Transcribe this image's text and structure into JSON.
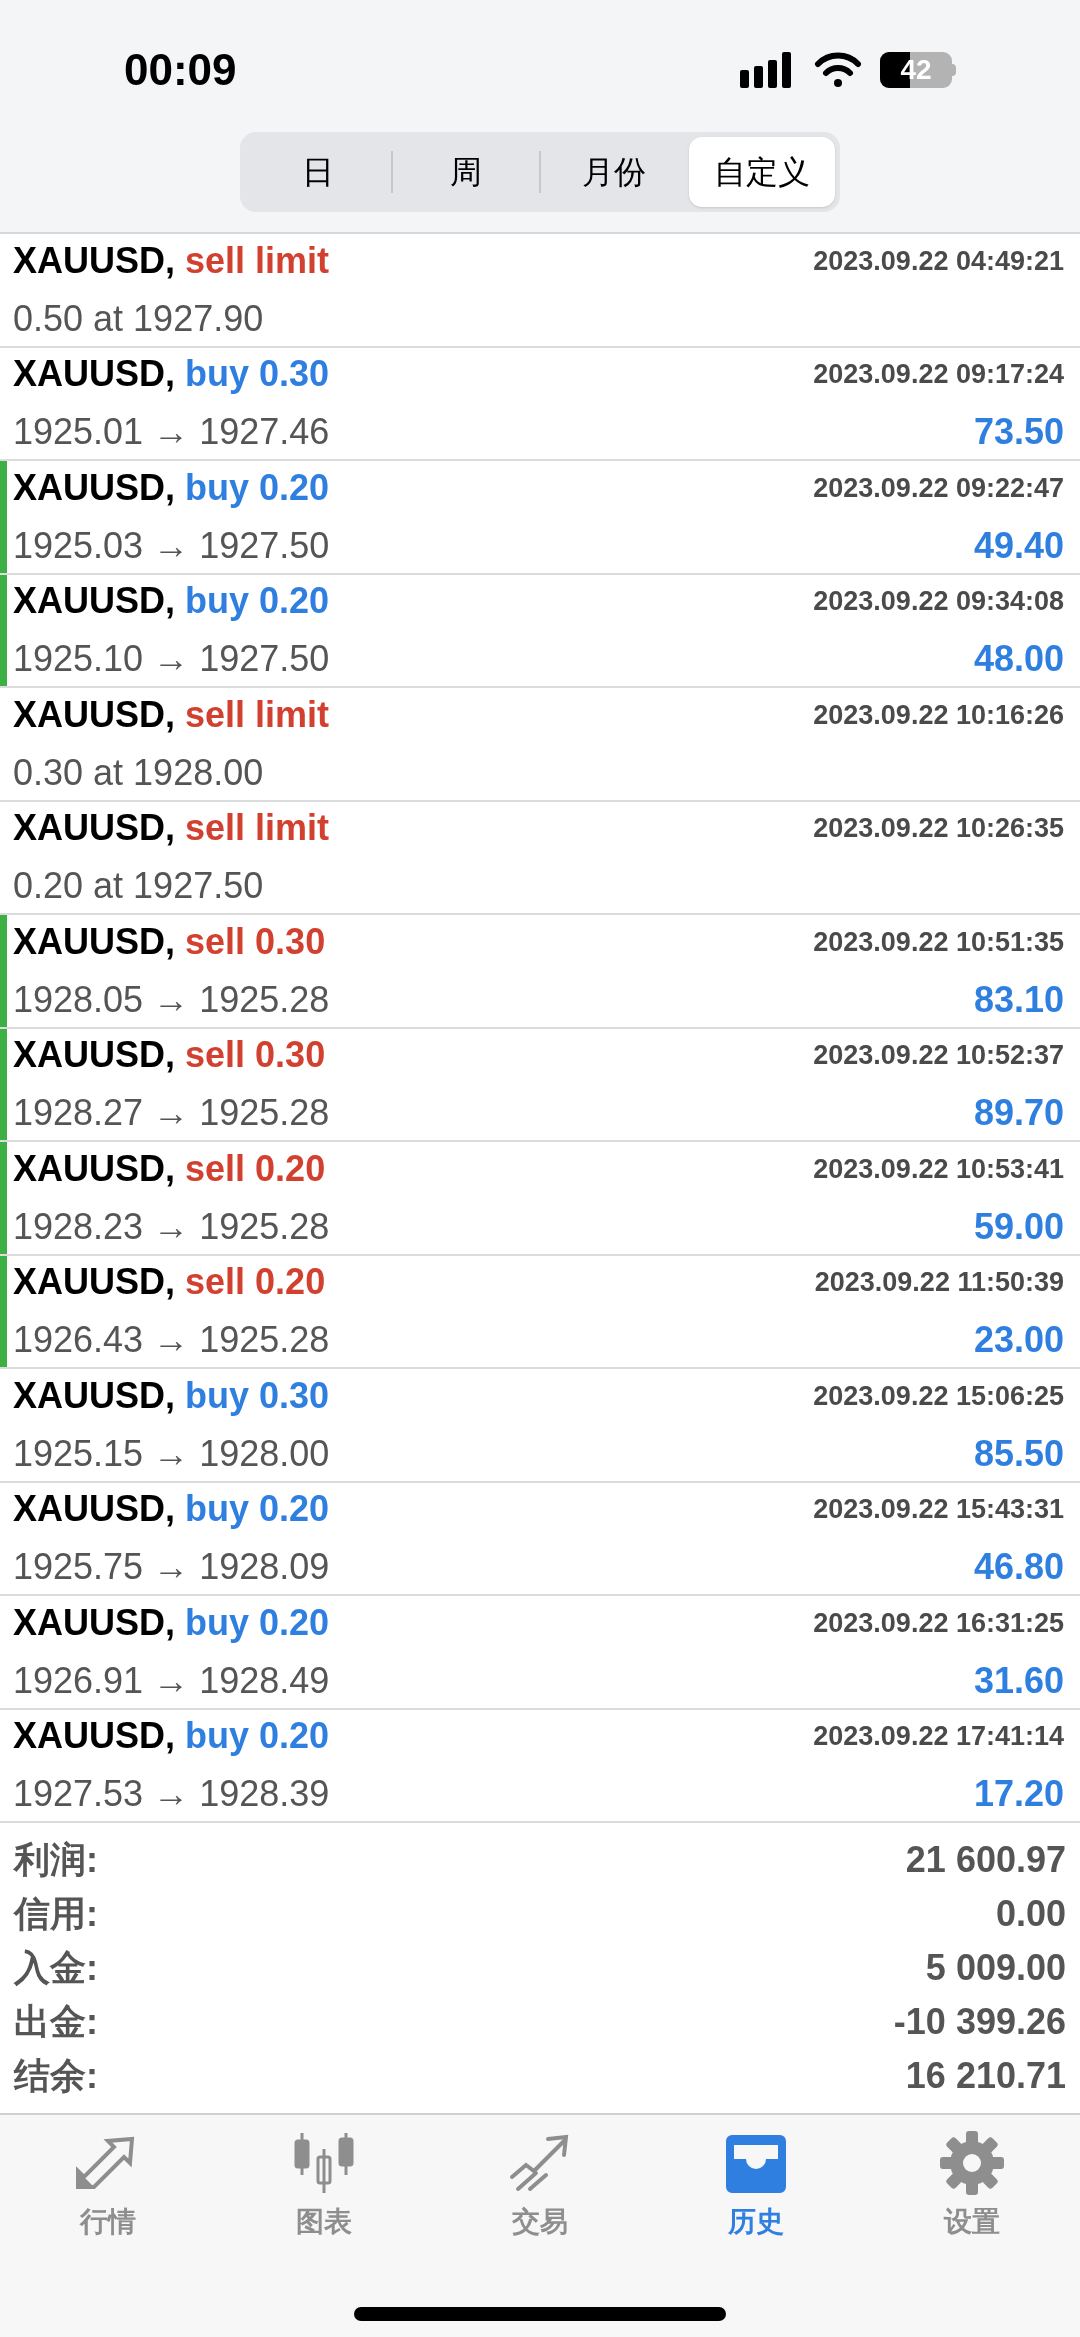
{
  "status_bar": {
    "time": "00:09",
    "battery": "42"
  },
  "segments": [
    {
      "label": "日",
      "selected": false
    },
    {
      "label": "周",
      "selected": false
    },
    {
      "label": "月份",
      "selected": false
    },
    {
      "label": "自定义",
      "selected": true
    }
  ],
  "orders": [
    {
      "kind": "pending",
      "symbol": "XAUUSD,",
      "color": "#d2412f",
      "type": "sell limit",
      "time": "2023.09.22 04:49:21",
      "detail": "0.50 at 1927.90",
      "highlighted": false
    },
    {
      "kind": "deal",
      "symbol": "XAUUSD,",
      "color": "#2f7fe0",
      "type": "buy 0.30",
      "time": "2023.09.22 09:17:24",
      "detail": "1925.01 → 1927.46",
      "profit": "73.50",
      "highlighted": false
    },
    {
      "kind": "deal",
      "symbol": "XAUUSD,",
      "color": "#2f7fe0",
      "type": "buy 0.20",
      "time": "2023.09.22 09:22:47",
      "detail": "1925.03 → 1927.50",
      "profit": "49.40",
      "highlighted": true
    },
    {
      "kind": "deal",
      "symbol": "XAUUSD,",
      "color": "#2f7fe0",
      "type": "buy 0.20",
      "time": "2023.09.22 09:34:08",
      "detail": "1925.10 → 1927.50",
      "profit": "48.00",
      "highlighted": true
    },
    {
      "kind": "pending",
      "symbol": "XAUUSD,",
      "color": "#d2412f",
      "type": "sell limit",
      "time": "2023.09.22 10:16:26",
      "detail": "0.30 at 1928.00",
      "highlighted": false
    },
    {
      "kind": "pending",
      "symbol": "XAUUSD,",
      "color": "#d2412f",
      "type": "sell limit",
      "time": "2023.09.22 10:26:35",
      "detail": "0.20 at 1927.50",
      "highlighted": false
    },
    {
      "kind": "deal",
      "symbol": "XAUUSD,",
      "color": "#d2412f",
      "type": "sell 0.30",
      "time": "2023.09.22 10:51:35",
      "detail": "1928.05 → 1925.28",
      "profit": "83.10",
      "highlighted": true
    },
    {
      "kind": "deal",
      "symbol": "XAUUSD,",
      "color": "#d2412f",
      "type": "sell 0.30",
      "time": "2023.09.22 10:52:37",
      "detail": "1928.27 → 1925.28",
      "profit": "89.70",
      "highlighted": true
    },
    {
      "kind": "deal",
      "symbol": "XAUUSD,",
      "color": "#d2412f",
      "type": "sell 0.20",
      "time": "2023.09.22 10:53:41",
      "detail": "1928.23 → 1925.28",
      "profit": "59.00",
      "highlighted": true
    },
    {
      "kind": "deal",
      "symbol": "XAUUSD,",
      "color": "#d2412f",
      "type": "sell 0.20",
      "time": "2023.09.22 11:50:39",
      "detail": "1926.43 → 1925.28",
      "profit": "23.00",
      "highlighted": true
    },
    {
      "kind": "deal",
      "symbol": "XAUUSD,",
      "color": "#2f7fe0",
      "type": "buy 0.30",
      "time": "2023.09.22 15:06:25",
      "detail": "1925.15 → 1928.00",
      "profit": "85.50",
      "highlighted": false
    },
    {
      "kind": "deal",
      "symbol": "XAUUSD,",
      "color": "#2f7fe0",
      "type": "buy 0.20",
      "time": "2023.09.22 15:43:31",
      "detail": "1925.75 → 1928.09",
      "profit": "46.80",
      "highlighted": false
    },
    {
      "kind": "deal",
      "symbol": "XAUUSD,",
      "color": "#2f7fe0",
      "type": "buy 0.20",
      "time": "2023.09.22 16:31:25",
      "detail": "1926.91 → 1928.49",
      "profit": "31.60",
      "highlighted": false
    },
    {
      "kind": "deal",
      "symbol": "XAUUSD,",
      "color": "#2f7fe0",
      "type": "buy 0.20",
      "time": "2023.09.22 17:41:14",
      "detail": "1927.53 → 1928.39",
      "profit": "17.20",
      "highlighted": false
    }
  ],
  "summary": [
    {
      "label": "利润:",
      "value": "21 600.97"
    },
    {
      "label": "信用:",
      "value": "0.00"
    },
    {
      "label": "入金:",
      "value": "5 009.00"
    },
    {
      "label": "出金:",
      "value": "-10 399.26"
    },
    {
      "label": "结余:",
      "value": "16 210.71"
    }
  ],
  "tab_bar": [
    {
      "kind": "quotes",
      "label": "行情",
      "selected": false
    },
    {
      "kind": "chart",
      "label": "图表",
      "selected": false
    },
    {
      "kind": "trade",
      "label": "交易",
      "selected": false
    },
    {
      "kind": "history",
      "label": "历史",
      "selected": true
    },
    {
      "kind": "settings",
      "label": "设置",
      "selected": false
    }
  ]
}
